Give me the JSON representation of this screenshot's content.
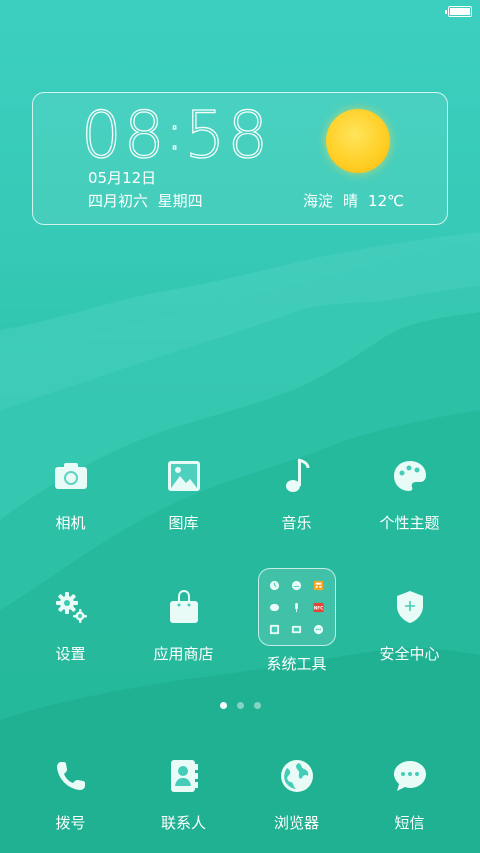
{
  "status_bar": {
    "battery_level": 1.0
  },
  "widget": {
    "time_hh": "08",
    "time_mm": "58",
    "time_sep": ":",
    "date": "05月12日",
    "lunar": "四月初六",
    "weekday": "星期四",
    "weather_location": "海淀",
    "weather_condition": "晴",
    "weather_temp": "12℃",
    "weather_icon": "sun-icon"
  },
  "apps_row1": [
    {
      "label": "相机",
      "icon": "camera-icon"
    },
    {
      "label": "图库",
      "icon": "gallery-icon"
    },
    {
      "label": "音乐",
      "icon": "music-note-icon"
    },
    {
      "label": "个性主题",
      "icon": "palette-icon"
    }
  ],
  "apps_row2": [
    {
      "label": "设置",
      "icon": "gear-icon"
    },
    {
      "label": "应用商店",
      "icon": "shopping-bag-icon"
    },
    {
      "label": "系统工具",
      "icon": "folder-icon"
    },
    {
      "label": "安全中心",
      "icon": "shield-icon"
    }
  ],
  "folder_mini_icons": [
    "clock-mini-icon",
    "speedometer-mini-icon",
    "calculator-mini-icon",
    "chat-mini-icon",
    "microphone-mini-icon",
    "nfc-mini-icon",
    "scanner-mini-icon",
    "tv-mini-icon",
    "message-mini-icon"
  ],
  "folder_nfc_text": "NFC",
  "page_indicator": {
    "pages": 3,
    "current": 1
  },
  "dock": [
    {
      "label": "拨号",
      "icon": "phone-icon"
    },
    {
      "label": "联系人",
      "icon": "contacts-icon"
    },
    {
      "label": "浏览器",
      "icon": "globe-icon"
    },
    {
      "label": "短信",
      "icon": "sms-bubble-icon"
    }
  ],
  "colors": {
    "sun": "#ffd027",
    "accent_red": "#e0463a",
    "calculator_orange": "#f6a623"
  }
}
